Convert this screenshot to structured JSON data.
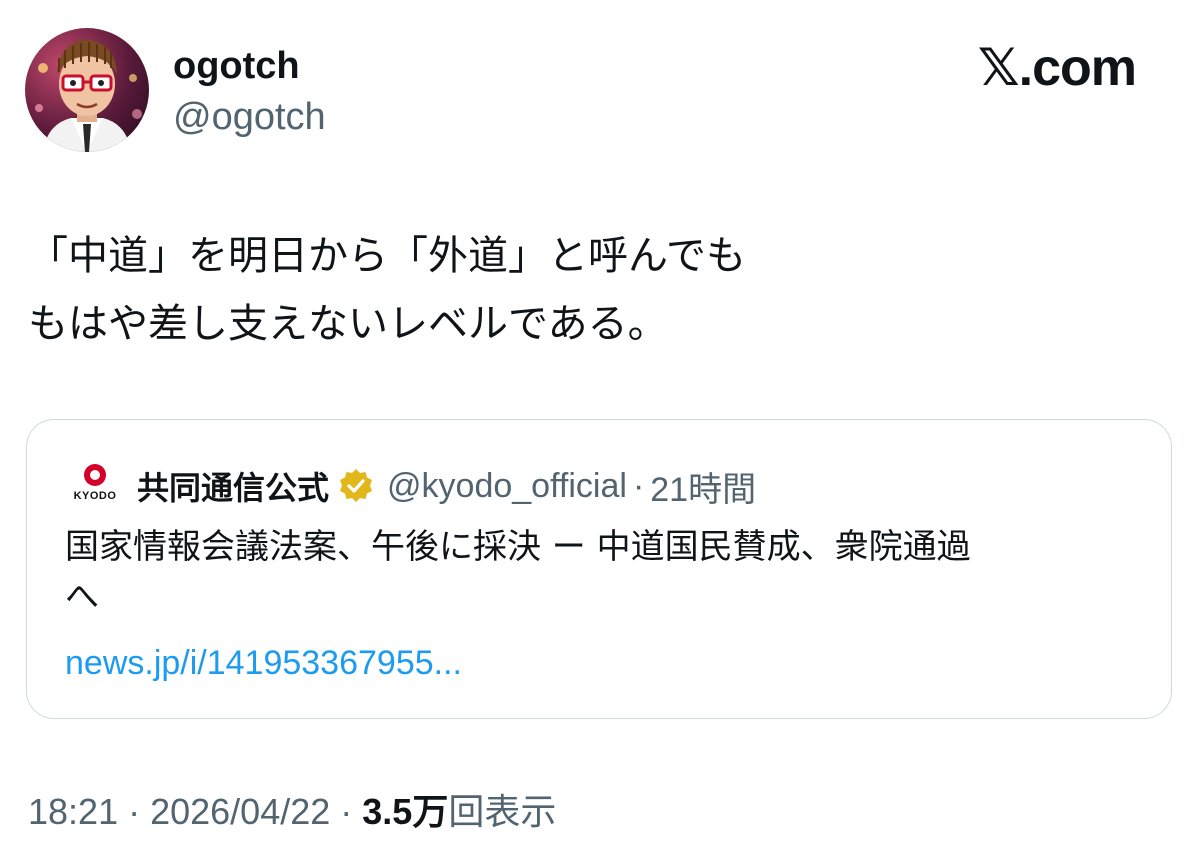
{
  "brand": {
    "label": "𝕏.com"
  },
  "author": {
    "display_name": "ogotch",
    "handle": "@ogotch",
    "avatar_icon": "caricature-avatar-icon"
  },
  "tweet": {
    "lines": [
      "「中道」を明日から「外道」と呼んでも",
      "もはや差し支えないレベルである。"
    ]
  },
  "quote": {
    "logo_icon": "kyodo-logo-icon",
    "logo_text": "KYODO",
    "name": "共同通信公式",
    "verified_icon": "verified-gold-badge-icon",
    "handle": "@kyodo_official",
    "separator": "·",
    "time": "21時間",
    "body_lines": [
      "国家情報会議法案、午後に採決 ー 中道国民賛成、衆院通過",
      "へ"
    ],
    "link": "news.jp/i/141953367955..."
  },
  "meta": {
    "time": "18:21",
    "sep1": " · ",
    "date": "2026/04/22",
    "sep2": " · ",
    "views_count": "3.5万",
    "views_label": "回表示"
  },
  "colors": {
    "text_primary": "#0f1419",
    "text_secondary": "#536471",
    "link": "#1d9bf0",
    "border": "#cfd9de",
    "verified_gold": "#e2b719",
    "kyodo_red": "#d4002a"
  }
}
